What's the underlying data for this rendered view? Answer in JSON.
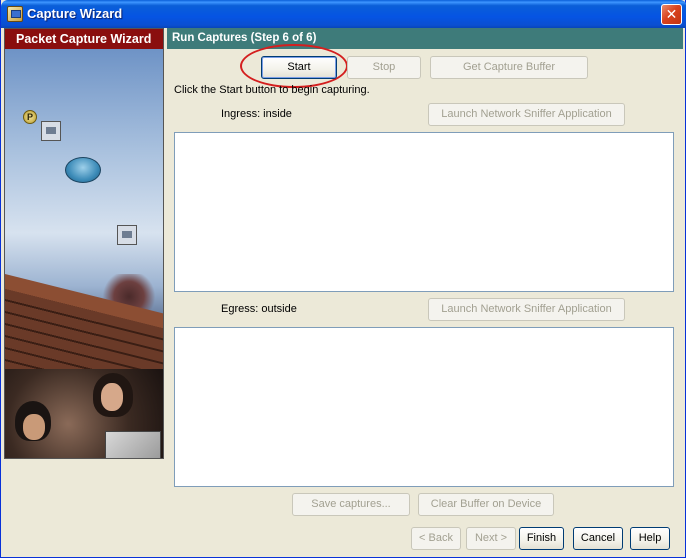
{
  "window": {
    "title": "Capture Wizard",
    "close_label": "✕"
  },
  "left_panel": {
    "title": "Packet Capture Wizard",
    "badge_letter": "P"
  },
  "step_header": {
    "title": "Run Captures  (Step 6 of 6)"
  },
  "capture_controls": {
    "start_label": "Start",
    "stop_label": "Stop",
    "get_buffer_label": "Get Capture Buffer",
    "instruction": "Click the Start button to begin capturing."
  },
  "ingress": {
    "label": "Ingress: inside",
    "launch_label": "Launch Network Sniffer Application",
    "content": ""
  },
  "egress": {
    "label": "Egress: outside",
    "launch_label": "Launch Network Sniffer Application",
    "content": ""
  },
  "buffer_actions": {
    "save_label": "Save captures...",
    "clear_label": "Clear Buffer on Device"
  },
  "wizard_nav": {
    "back_label": "< Back",
    "next_label": "Next >",
    "finish_label": "Finish",
    "cancel_label": "Cancel",
    "help_label": "Help"
  },
  "colors": {
    "title_bar": "#0a5fd8",
    "left_header": "#8a0e0e",
    "step_header": "#3e7b7a",
    "highlight": "#d41f1f"
  }
}
